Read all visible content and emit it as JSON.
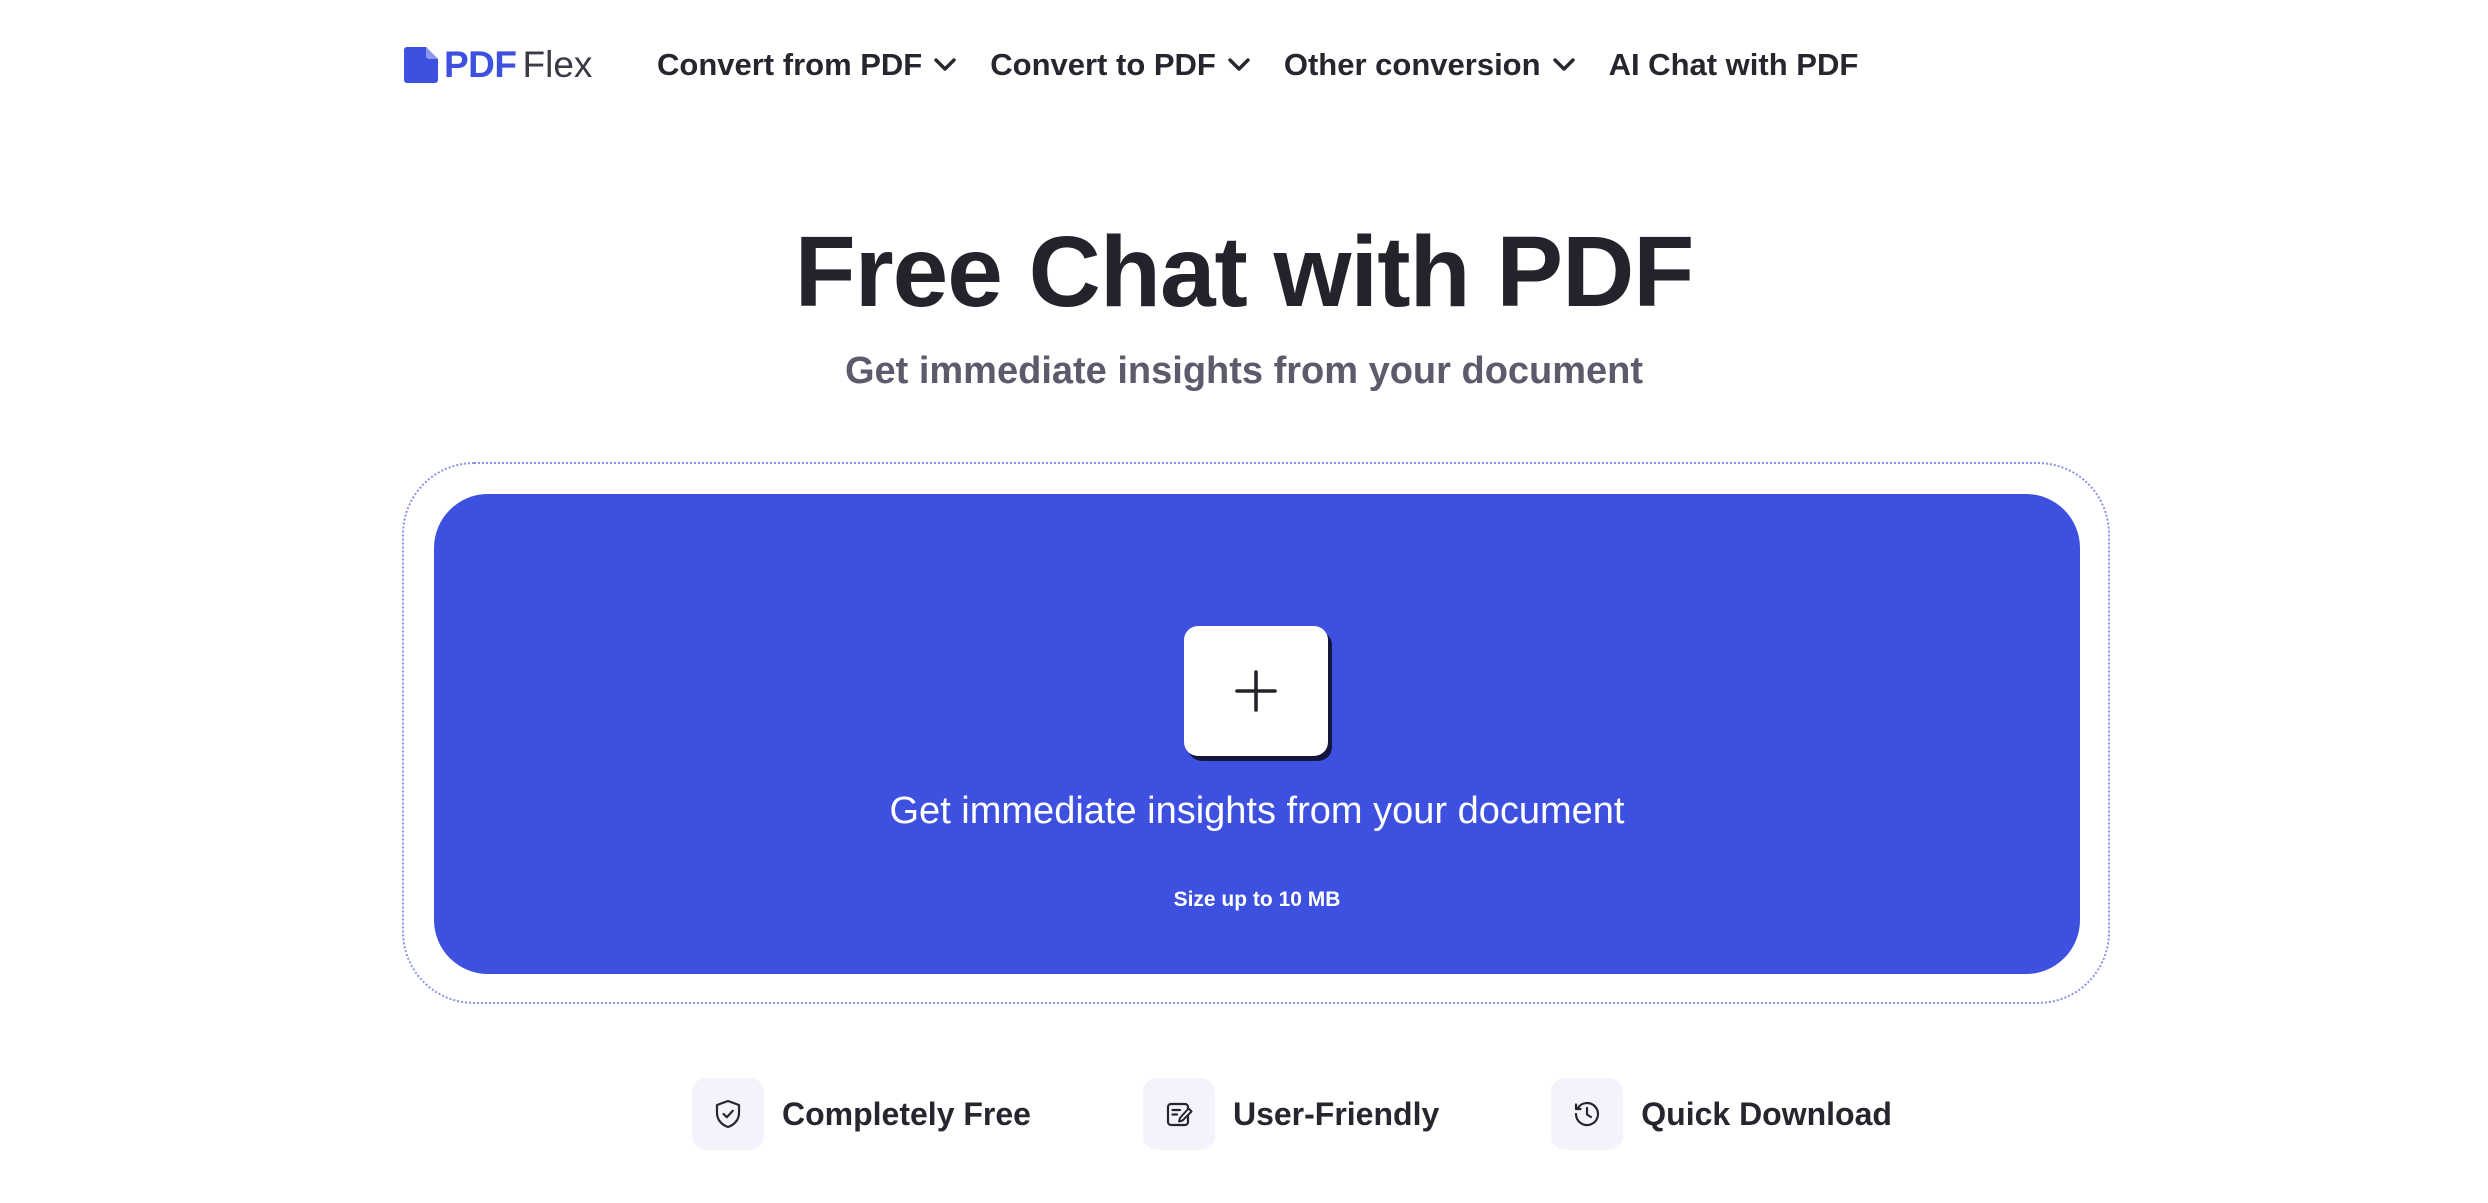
{
  "header": {
    "logo": {
      "part1": "PDF",
      "part2": "Flex"
    },
    "nav": [
      {
        "label": "Convert from PDF",
        "has_dropdown": true
      },
      {
        "label": "Convert to PDF",
        "has_dropdown": true
      },
      {
        "label": "Other conversion",
        "has_dropdown": true
      },
      {
        "label": "AI Chat with PDF",
        "has_dropdown": false
      }
    ]
  },
  "hero": {
    "title": "Free Chat with PDF",
    "subtitle": "Get immediate insights from your document"
  },
  "upload": {
    "button_icon": "plus-icon",
    "text": "Get immediate insights from your document",
    "size_note": "Size up to 10 MB"
  },
  "features": [
    {
      "label": "Completely Free",
      "icon": "shield-check-icon"
    },
    {
      "label": "User-Friendly",
      "icon": "edit-icon"
    },
    {
      "label": "Quick Download",
      "icon": "history-icon"
    }
  ],
  "colors": {
    "accent": "#3d50df",
    "text": "#23232b",
    "subtitle": "#5b5b6b",
    "feature_icon_bg": "#f3f4fb"
  }
}
